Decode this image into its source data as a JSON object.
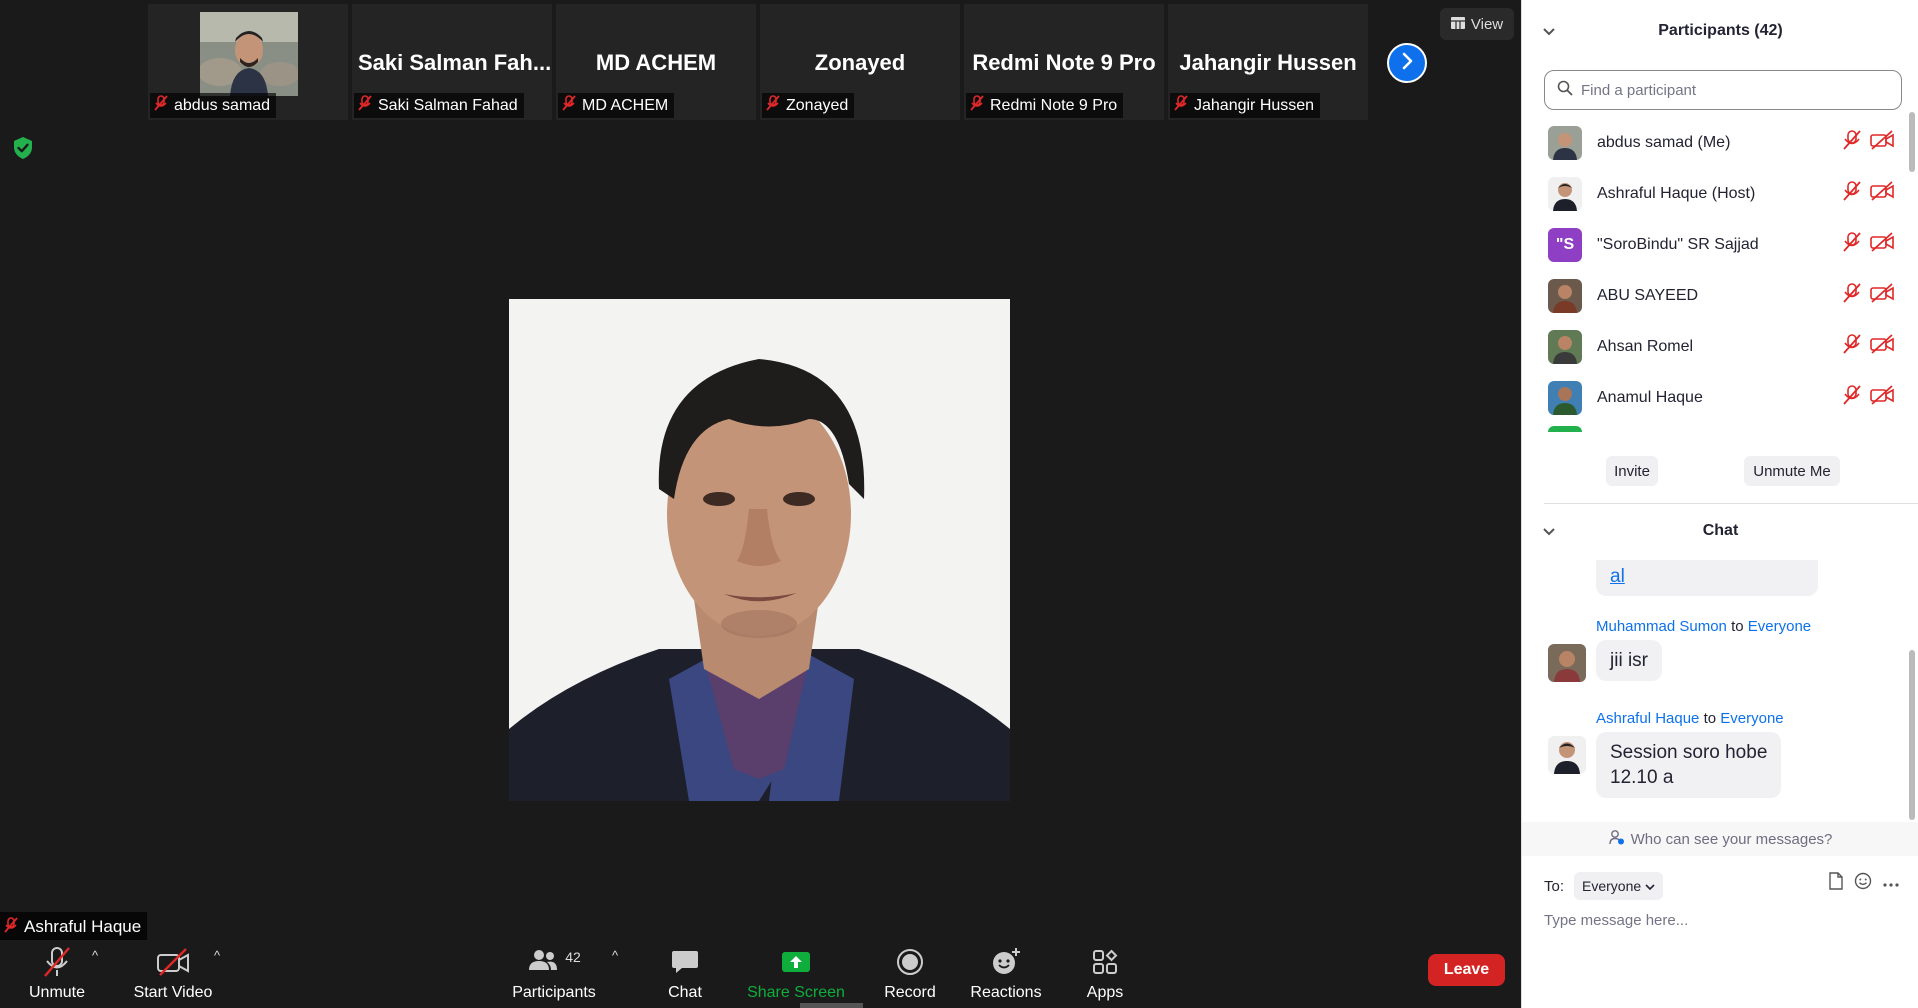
{
  "strip": {
    "tiles": [
      {
        "display_name": "",
        "label": "abdus samad",
        "has_photo": true
      },
      {
        "display_name": "Saki  Salman  Fah...",
        "label": "Saki Salman Fahad"
      },
      {
        "display_name": "MD ACHEM",
        "label": "MD ACHEM"
      },
      {
        "display_name": "Zonayed",
        "label": "Zonayed"
      },
      {
        "display_name": "Redmi Note 9 Pro",
        "label": "Redmi Note 9 Pro"
      },
      {
        "display_name": "Jahangir Hussen",
        "label": "Jahangir Hussen"
      }
    ],
    "view_label": "View"
  },
  "speaker": {
    "name": "Ashraful Haque"
  },
  "toolbar": {
    "unmute": "Unmute",
    "start_video": "Start Video",
    "participants": "Participants",
    "participants_count": "42",
    "chat": "Chat",
    "share_screen": "Share Screen",
    "record": "Record",
    "reactions": "Reactions",
    "apps": "Apps",
    "leave": "Leave"
  },
  "colors": {
    "share_green": "#0ead3c",
    "accent_blue": "#0e71eb",
    "leave_red": "#d42323",
    "muted_red": "#e02828"
  },
  "participants_panel": {
    "title": "Participants (42)",
    "search_placeholder": "Find a participant",
    "list": [
      {
        "name": "abdus samad (Me)",
        "avatar": "photo"
      },
      {
        "name": "Ashraful Haque (Host)",
        "avatar": "photo"
      },
      {
        "name": "\"SoroBindu\" SR Sajjad",
        "avatar": "initial",
        "initial": "\"S"
      },
      {
        "name": "ABU SAYEED",
        "avatar": "photo"
      },
      {
        "name": "Ahsan Romel",
        "avatar": "photo"
      },
      {
        "name": "Anamul Haque",
        "avatar": "photo"
      }
    ],
    "invite": "Invite",
    "unmute_me": "Unmute Me"
  },
  "chat_panel": {
    "title": "Chat",
    "partial_message": "al",
    "messages": [
      {
        "sender": "Muhammad Sumon",
        "to_word": "to",
        "recipient": "Everyone",
        "text": "jii isr"
      },
      {
        "sender": "Ashraful Haque",
        "to_word": "to",
        "recipient": "Everyone",
        "text_line1": "Session soro hobe",
        "text_line2": "12.10 a"
      }
    ],
    "who_can_see": "Who can see your messages?",
    "to_label": "To:",
    "to_value": "Everyone",
    "message_placeholder": "Type message here..."
  }
}
